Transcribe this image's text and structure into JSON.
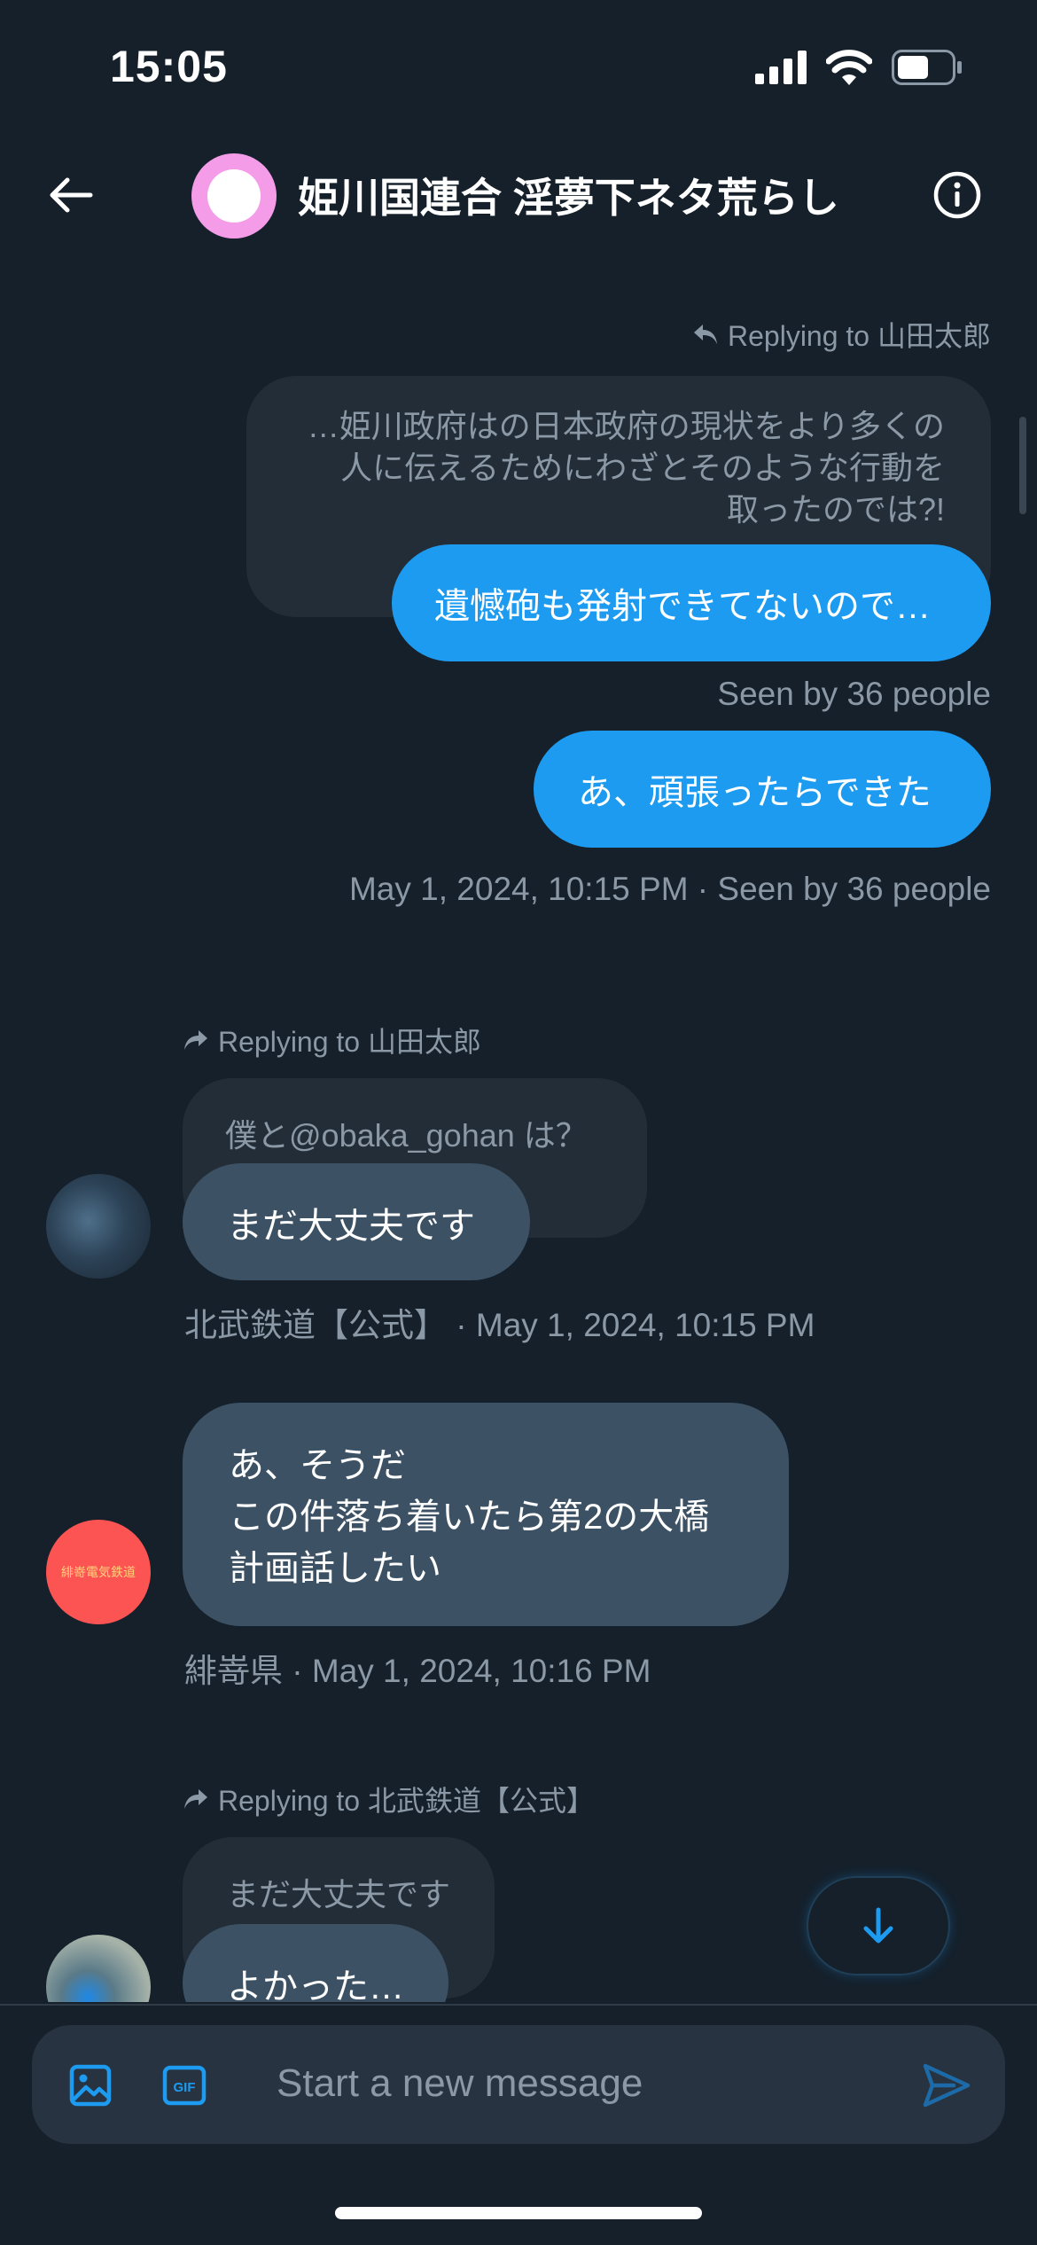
{
  "status_bar": {
    "time": "15:05"
  },
  "header": {
    "title": "姫川国連合 淫夢下ネタ荒らし"
  },
  "messages": {
    "m1": {
      "reply_label": "Replying to 山田太郎",
      "quoted_lines": [
        "…姫川政府はの日本政府の現状をより多くの",
        "人に伝えるためにわざとそのような行動を",
        "取ったのでは?!"
      ],
      "text": "遺憾砲も発射できてないので…",
      "seen": "Seen by 36 people"
    },
    "m2": {
      "text": "あ、頑張ったらできた",
      "meta": "May 1, 2024, 10:15 PM · Seen by 36 people"
    },
    "m3": {
      "reply_label": "Replying to 山田太郎",
      "quoted": "僕と@obaka_gohan は？",
      "text": "まだ大丈夫です",
      "meta": "北武鉄道【公式】 · May 1, 2024, 10:15 PM"
    },
    "m4": {
      "lines": [
        "あ、そうだ",
        "この件落ち着いたら第2の大橋",
        "計画話したい"
      ],
      "meta": "緋嵜県 · May 1, 2024, 10:16 PM",
      "avatar_text": "緋嵜電気鉄道"
    },
    "m5": {
      "reply_label": "Replying to 北武鉄道【公式】",
      "quoted": "まだ大丈夫です",
      "text": "よかった…"
    }
  },
  "composer": {
    "placeholder": "Start a new message"
  },
  "icons": {
    "back": "arrow-left-icon",
    "info": "info-icon",
    "image": "image-icon",
    "gif": "gif-icon",
    "send": "send-icon",
    "scroll_down": "arrow-down-icon",
    "reply": "reply-arrow-icon",
    "forward_reply": "reply-forward-icon"
  },
  "colors": {
    "background": "#15202b",
    "accent": "#1d9bf0",
    "incoming_bubble": "#3c5264",
    "quoted_bubble": "#222d38",
    "meta_text": "#8b98a5"
  }
}
